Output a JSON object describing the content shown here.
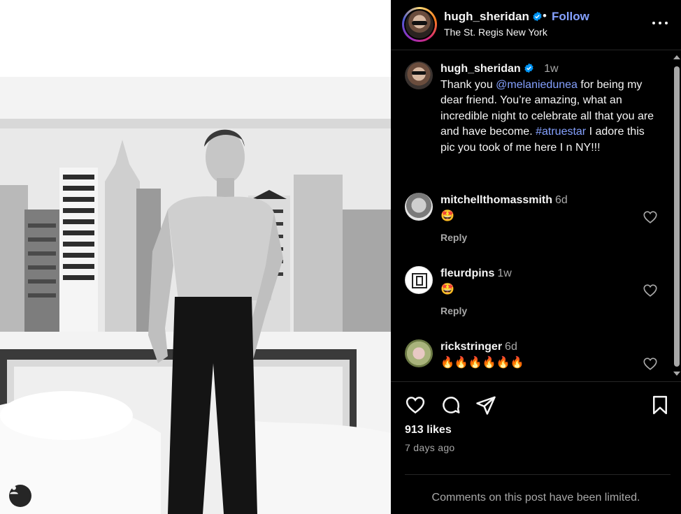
{
  "post": {
    "username": "hugh_sheridan",
    "separator": "•",
    "follow_label": "Follow",
    "location": "The St. Regis New York",
    "more_icon": "more-horizontal-icon",
    "verified_color": "#0095f6",
    "link_color": "#85a1ff"
  },
  "caption": {
    "username": "hugh_sheridan",
    "time": "1w",
    "text_before": "Thank you ",
    "mention": "@melaniedunea",
    "text_middle": " for being my dear friend. You’re amazing, what an incredible night to celebrate all that you are and have become. ",
    "hashtag": "#atruestar",
    "text_after": " I adore this pic you took of me here I n NY!!!"
  },
  "comments": [
    {
      "username": "mitchellthomassmith",
      "time": "6d",
      "text": "🤩",
      "reply_label": "Reply"
    },
    {
      "username": "fleurdpins",
      "time": "1w",
      "text": "🤩",
      "reply_label": "Reply"
    },
    {
      "username": "rickstringer",
      "time": "6d",
      "text": "🔥🔥🔥🔥🔥🔥"
    }
  ],
  "actions": {
    "like_icon": "heart-icon",
    "comment_icon": "comment-icon",
    "share_icon": "send-icon",
    "save_icon": "bookmark-icon"
  },
  "likes": "913 likes",
  "posted_ago": "7 days ago",
  "comments_limited": "Comments on this post have been limited."
}
